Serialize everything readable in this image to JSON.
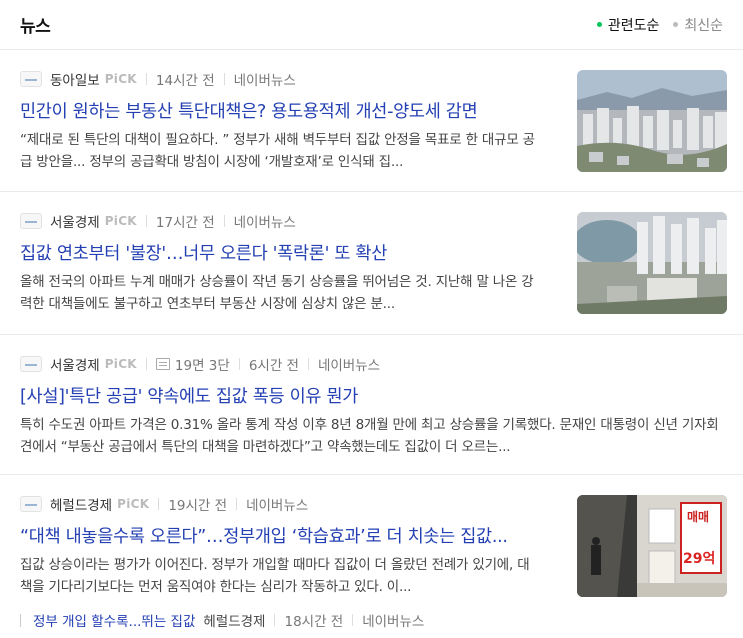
{
  "header": {
    "title": "뉴스",
    "sort_options": [
      {
        "label": "관련도순",
        "active": true
      },
      {
        "label": "최신순",
        "active": false
      }
    ]
  },
  "articles": [
    {
      "press": "동아일보",
      "pick": "PiCK",
      "time": "14시간 전",
      "source": "네이버뉴스",
      "title": "민간이 원하는 부동산 특단대책은? 용도용적제 개선-양도세 감면",
      "description": "“제대로 된 특단의 대책이 필요하다. ” 정부가 새해 벽두부터 집값 안정을 목표로 한 대규모 공급 방안을... 정부의 공급확대 방침이 시장에 ‘개발호재’로 인식돼 집...",
      "thumbnail": "city-apartments-photo"
    },
    {
      "press": "서울경제",
      "pick": "PiCK",
      "time": "17시간 전",
      "source": "네이버뉴스",
      "title": "집값 연초부터 '불장'…너무 오른다 '폭락론' 또 확산",
      "description": "올해 전국의 아파트 누계 매매가 상승률이 작년 동기 상승률을 뛰어넘은 것. 지난해 말 나온 강력한 대책들에도 불구하고 연초부터 부동산 시장에 심상치 않은 분...",
      "thumbnail": "lakeside-apartments-photo"
    },
    {
      "press": "서울경제",
      "pick": "PiCK",
      "page": "19면 3단",
      "time": "6시간 전",
      "source": "네이버뉴스",
      "title": "[사설]'특단 공급' 약속에도 집값 폭등 이유 뭔가",
      "description": "특히 수도권 아파트 가격은 0.31% 올라 통계 작성 이후 8년 8개월 만에 최고 상승률을 기록했다. 문재인 대통령이 신년 기자회견에서 “부동산 공급에서 특단의 대책을 마련하겠다”고 약속했는데도 집값이 더 오르는..."
    },
    {
      "press": "헤럴드경제",
      "pick": "PiCK",
      "time": "19시간 전",
      "source": "네이버뉴스",
      "title": "“대책 내놓을수록 오른다”…정부개입 ‘학습효과’로 더 치솟는 집값...",
      "description": "집값 상승이라는 평가가 이어진다. 정부가 개입할 때마다 집값이 더 올랐던 전례가 있기에, 대책을 기다리기보다는 먼저 움직여야 한다는 심리가 작동하고 있다. 이...",
      "thumbnail": "realestate-agency-photo",
      "thumb_sign_text": "매매",
      "thumb_price_text": "29억",
      "related": {
        "title": "정부 개입 할수록...뛰는 집값",
        "press": "헤럴드경제",
        "time": "18시간 전",
        "source": "네이버뉴스"
      }
    }
  ],
  "colors": {
    "link_blue": "#2440b3",
    "active_green": "#03c75a"
  }
}
